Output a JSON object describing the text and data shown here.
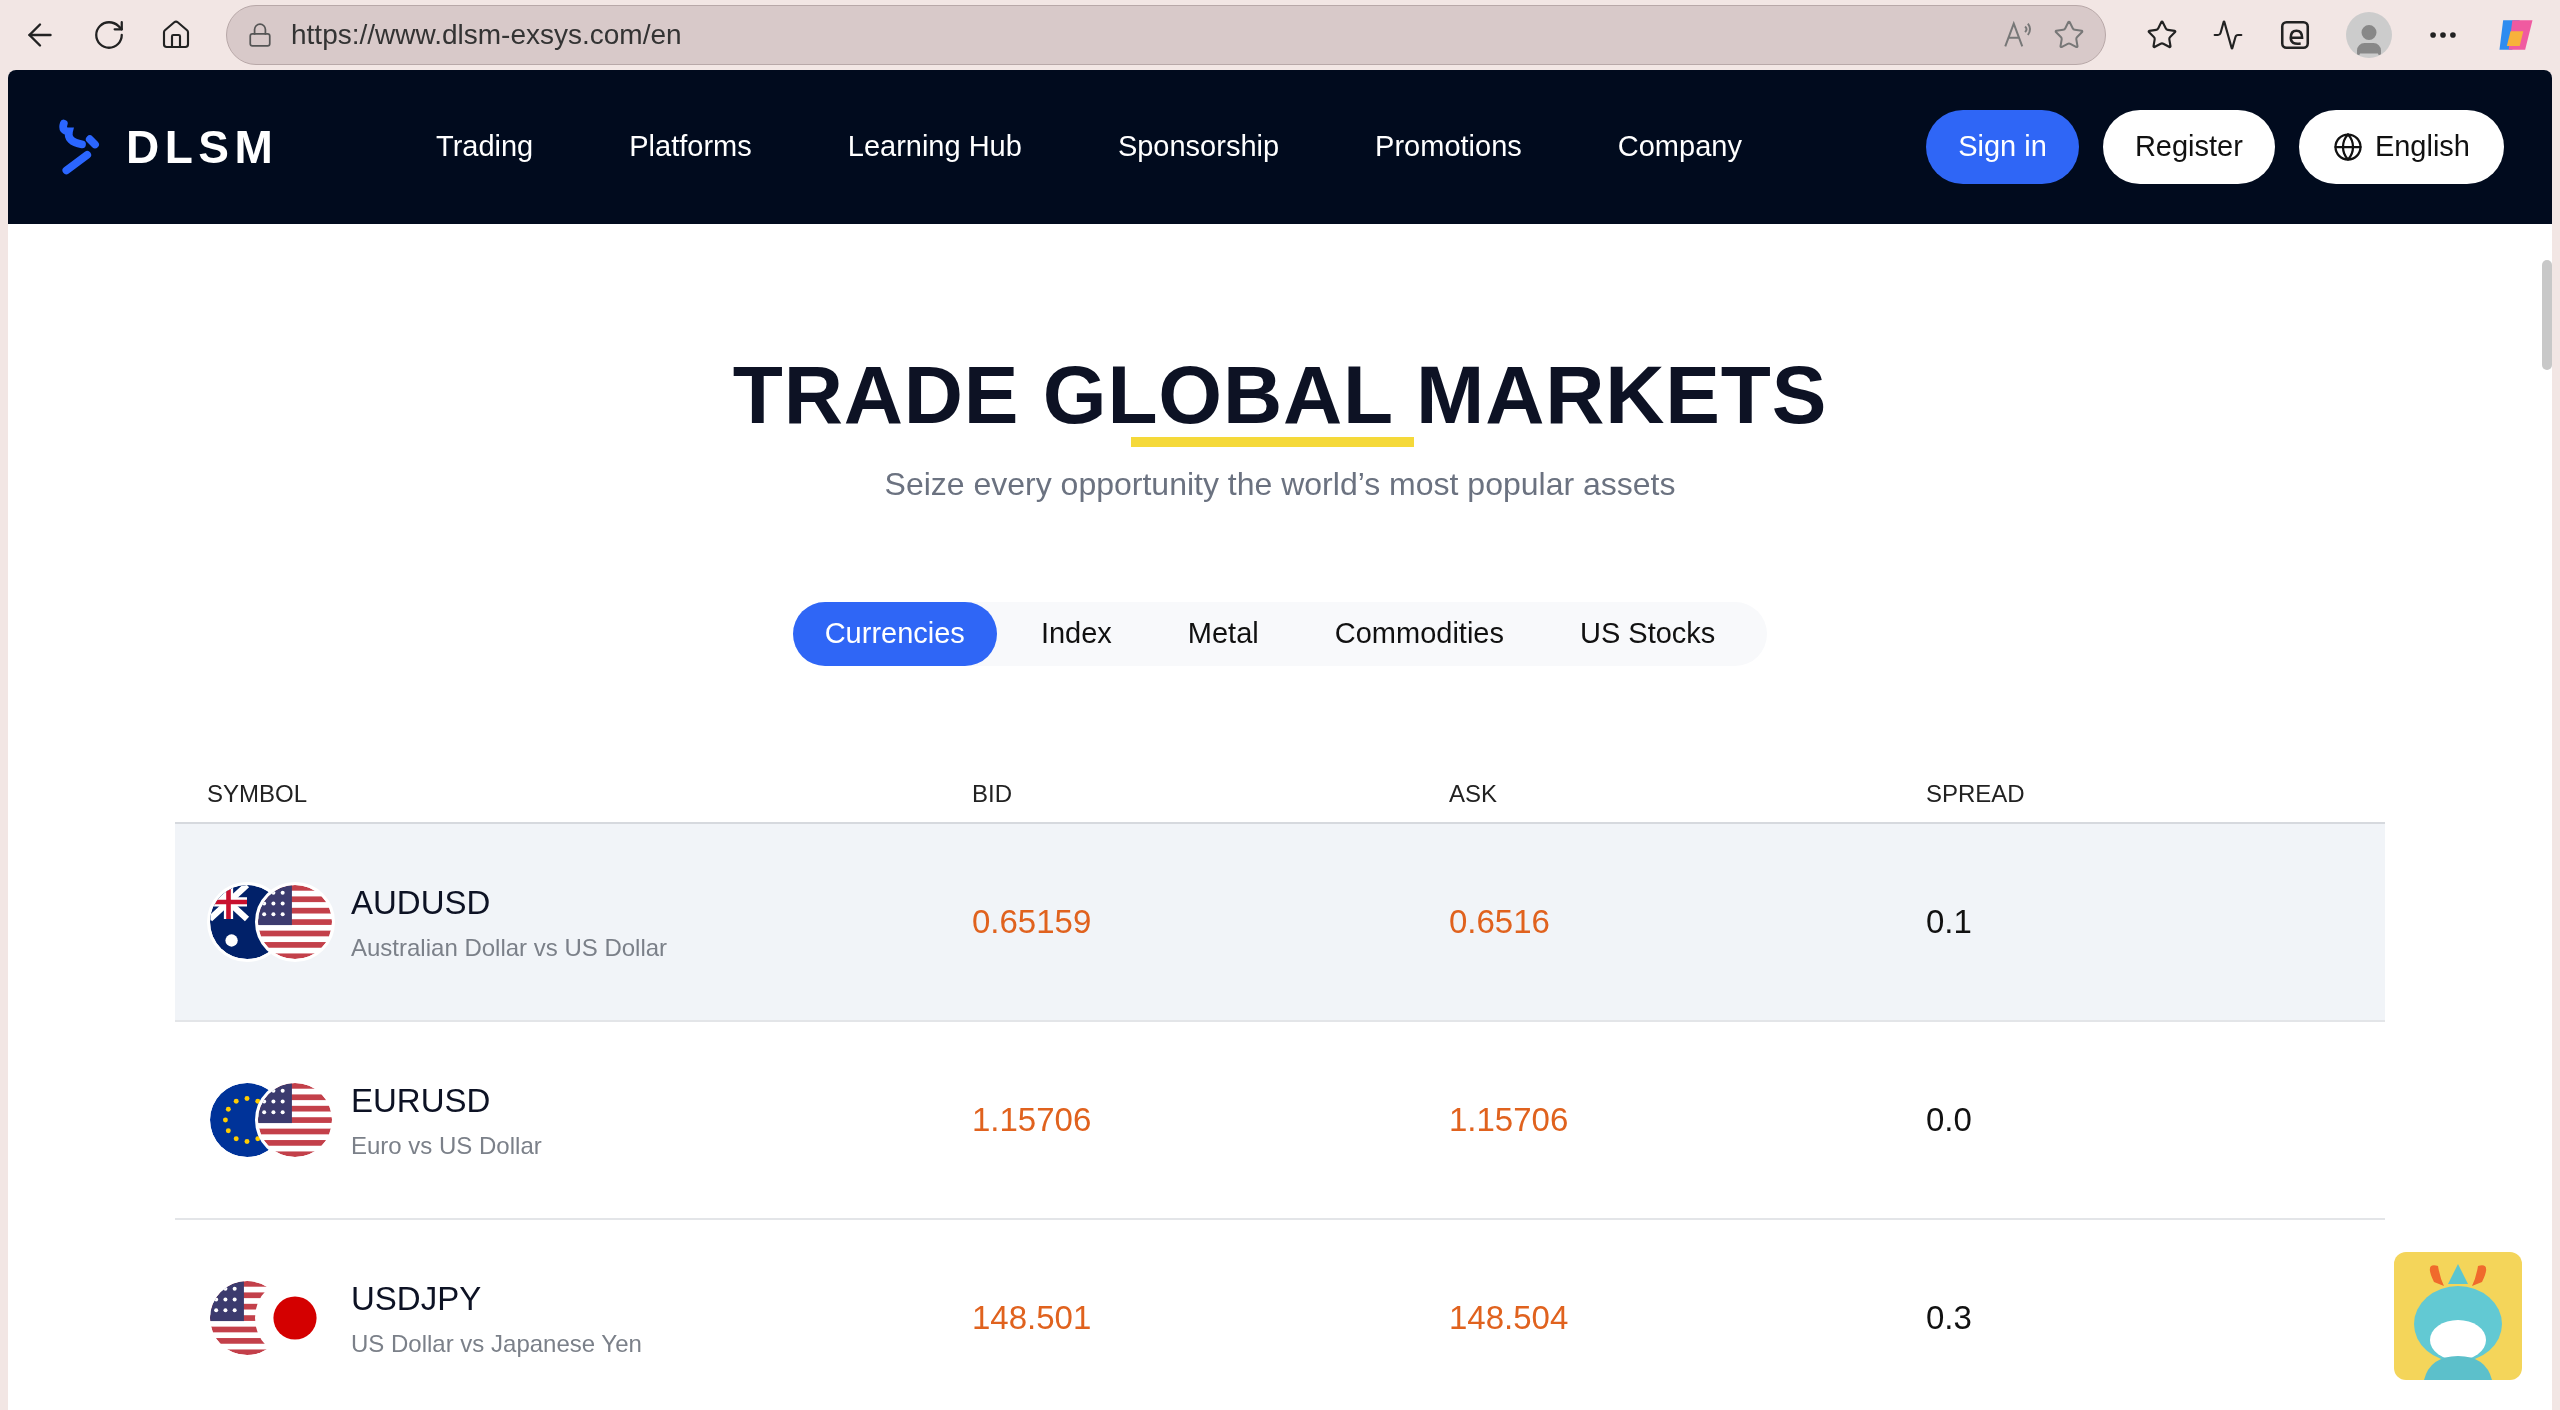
{
  "browser": {
    "url": "https://www.dlsm-exsys.com/en"
  },
  "nav": {
    "logo": "DLSM",
    "items": [
      "Trading",
      "Platforms",
      "Learning Hub",
      "Sponsorship",
      "Promotions",
      "Company"
    ],
    "sign_in": "Sign in",
    "register": "Register",
    "language": "English"
  },
  "hero": {
    "title": "TRADE GLOBAL MARKETS",
    "subtitle": "Seize every opportunity the world’s most popular assets"
  },
  "tabs": [
    {
      "label": "Currencies",
      "selected": true
    },
    {
      "label": "Index",
      "selected": false
    },
    {
      "label": "Metal",
      "selected": false
    },
    {
      "label": "Commodities",
      "selected": false
    },
    {
      "label": "US Stocks",
      "selected": false
    }
  ],
  "table": {
    "columns": [
      "SYMBOL",
      "BID",
      "ASK",
      "SPREAD"
    ],
    "rows": [
      {
        "symbol": "AUDUSD",
        "name": "Australian Dollar vs US Dollar",
        "bid": "0.65159",
        "ask": "0.6516",
        "spread": "0.1",
        "selected": true,
        "flags": [
          {
            "kind": "australia"
          },
          {
            "kind": "usa"
          }
        ]
      },
      {
        "symbol": "EURUSD",
        "name": "Euro vs US Dollar",
        "bid": "1.15706",
        "ask": "1.15706",
        "spread": "0.0",
        "selected": false,
        "flags": [
          {
            "kind": "eu"
          },
          {
            "kind": "usa"
          }
        ]
      },
      {
        "symbol": "USDJPY",
        "name": "US Dollar vs Japanese Yen",
        "bid": "148.501",
        "ask": "148.504",
        "spread": "0.3",
        "selected": false,
        "flags": [
          {
            "kind": "usa"
          },
          {
            "kind": "japan"
          }
        ]
      }
    ]
  }
}
